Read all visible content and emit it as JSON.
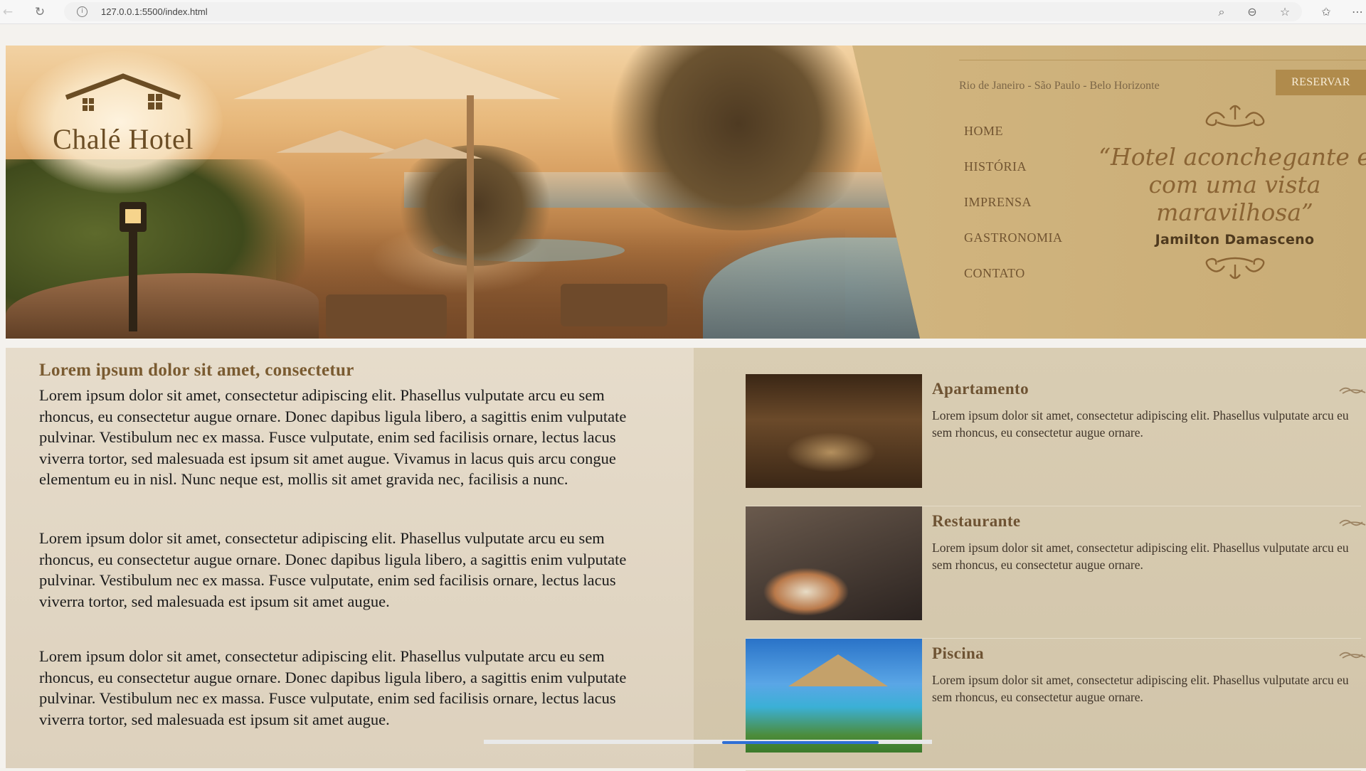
{
  "browser": {
    "url": "127.0.0.1:5500/index.html",
    "icons": [
      "back-arrow-icon",
      "reload-icon",
      "site-info-icon",
      "zoom-icon",
      "minus-circle-icon",
      "star-icon",
      "favorites-icon",
      "more-icon"
    ]
  },
  "header": {
    "logo_text": "Chalé Hotel",
    "locations": "Rio de Janeiro - São Paulo - Belo Horizonte",
    "reserve_label": "RESERVAR",
    "menu": [
      "HOME",
      "HISTÓRIA",
      "IMPRENSA",
      "GASTRONOMIA",
      "CONTATO"
    ],
    "quote": "“Hotel aconchegante e com uma vista maravilhosa”",
    "author": "Jamilton Damasceno"
  },
  "article": {
    "title": "Lorem ipsum dolor sit amet, consectetur",
    "paragraphs": [
      "Lorem ipsum dolor sit amet, consectetur adipiscing elit. Phasellus vulputate arcu eu sem rhoncus, eu consectetur augue ornare. Donec dapibus ligula libero, a sagittis enim vulputate pulvinar. Vestibulum nec ex massa. Fusce vulputate, enim sed facilisis ornare, lectus lacus viverra tortor, sed malesuada est ipsum sit amet augue. Vivamus in lacus quis arcu congue elementum eu in nisl. Nunc neque est, mollis sit amet gravida nec, facilisis a nunc.",
      "Lorem ipsum dolor sit amet, consectetur adipiscing elit. Phasellus vulputate arcu eu sem rhoncus, eu consectetur augue ornare. Donec dapibus ligula libero, a sagittis enim vulputate pulvinar. Vestibulum nec ex massa. Fusce vulputate, enim sed facilisis ornare, lectus lacus viverra tortor, sed malesuada est ipsum sit amet augue.",
      "Lorem ipsum dolor sit amet, consectetur adipiscing elit. Phasellus vulputate arcu eu sem rhoncus, eu consectetur augue ornare. Donec dapibus ligula libero, a sagittis enim vulputate pulvinar. Vestibulum nec ex massa. Fusce vulputate, enim sed facilisis ornare, lectus lacus viverra tortor, sed malesuada est ipsum sit amet augue."
    ]
  },
  "cards": [
    {
      "title": "Apartamento",
      "text": "Lorem ipsum dolor sit amet, consectetur adipiscing elit. Phasellus vulputate arcu eu sem rhoncus, eu consectetur augue ornare."
    },
    {
      "title": "Restaurante",
      "text": "Lorem ipsum dolor sit amet, consectetur adipiscing elit. Phasellus vulputate arcu eu sem rhoncus, eu consectetur augue ornare."
    },
    {
      "title": "Piscina",
      "text": "Lorem ipsum dolor sit amet, consectetur adipiscing elit. Phasellus vulputate arcu eu sem rhoncus, eu consectetur augue ornare."
    }
  ],
  "colors": {
    "accent": "#b08b4c",
    "header_bg": "#d6bb86",
    "title_brown": "#7a5b31"
  }
}
